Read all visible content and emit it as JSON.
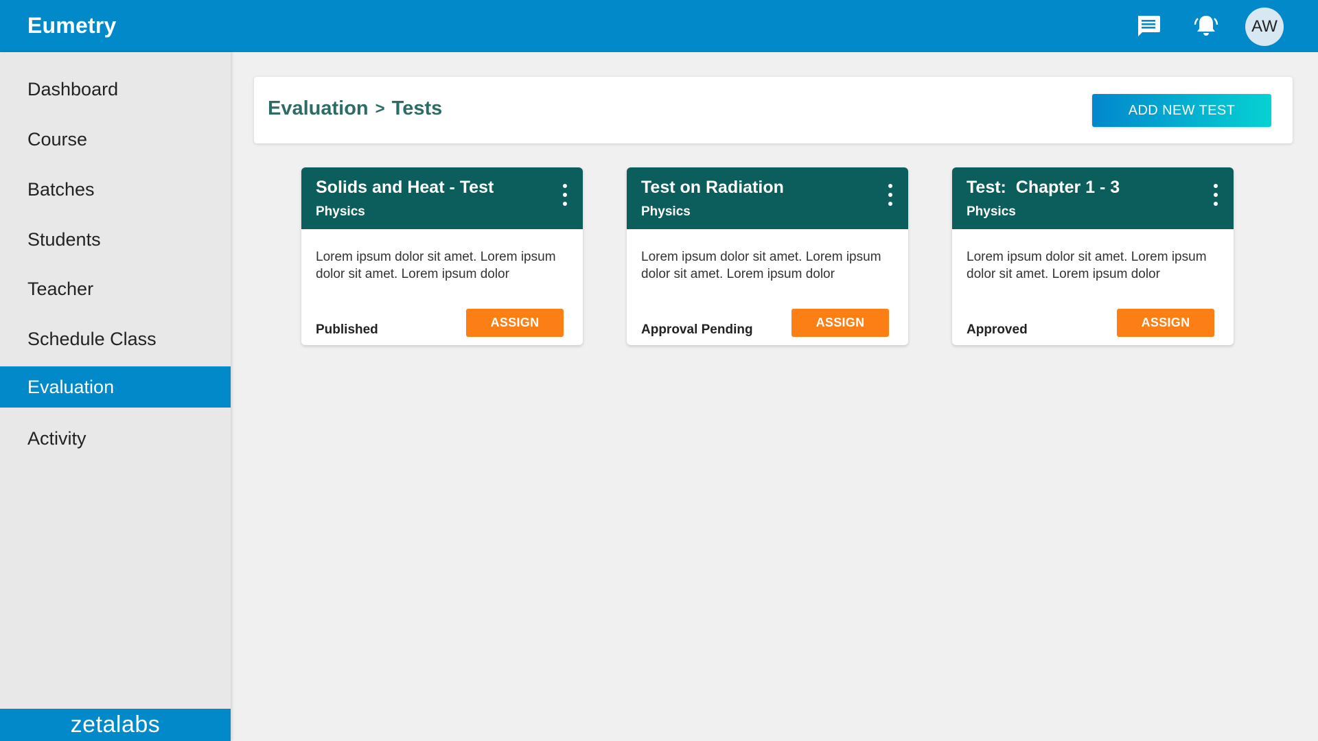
{
  "app": {
    "title": "Eumetry"
  },
  "header": {
    "avatar_initials": "AW",
    "icons": [
      "chat-icon",
      "bell-icon"
    ],
    "accent_color": "#0289c9"
  },
  "sidebar": {
    "items": [
      {
        "label": "Dashboard",
        "active": false
      },
      {
        "label": "Course",
        "active": false
      },
      {
        "label": "Batches",
        "active": false
      },
      {
        "label": "Students",
        "active": false
      },
      {
        "label": "Teacher",
        "active": false
      },
      {
        "label": "Schedule Class",
        "active": false
      },
      {
        "label": "Evaluation",
        "active": true
      },
      {
        "label": "Activity",
        "active": false
      }
    ],
    "footer_logo": "zetalabs"
  },
  "page": {
    "breadcrumb": {
      "parent": "Evaluation",
      "separator": ">",
      "current": "Tests"
    },
    "add_button_label": "ADD NEW TEST"
  },
  "tests": [
    {
      "title": "Solids and Heat - Test",
      "subject": "Physics",
      "description": "Lorem ipsum dolor sit amet. Lorem ipsum dolor sit amet. Lorem ipsum dolor",
      "status": "Published",
      "action_label": "ASSIGN"
    },
    {
      "title": "Test on Radiation",
      "subject": "Physics",
      "description": "Lorem ipsum dolor sit amet. Lorem ipsum dolor sit amet. Lorem ipsum dolor",
      "status": "Approval Pending",
      "action_label": "ASSIGN"
    },
    {
      "title": "Test:  Chapter 1 - 3",
      "subject": "Physics",
      "description": "Lorem ipsum dolor sit amet. Lorem ipsum dolor sit amet. Lorem ipsum dolor",
      "status": "Approved",
      "action_label": "ASSIGN"
    }
  ],
  "colors": {
    "card_header": "#0b5e5c",
    "assign_button": "#fc7f15",
    "breadcrumb_text": "#2d6b66"
  }
}
